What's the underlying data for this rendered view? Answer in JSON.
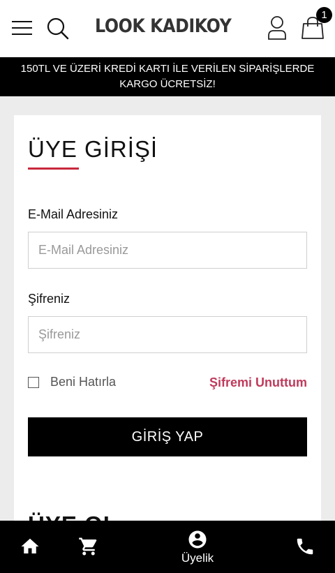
{
  "header": {
    "menu_icon": "hamburger-menu-icon",
    "search_icon": "search-icon",
    "logo_text": "LOOK KADIKOY",
    "user_icon": "user-icon",
    "cart_icon": "shopping-bag-icon",
    "cart_count": "1"
  },
  "promo": {
    "line1": "150TL VE ÜZERİ KREDİ KARTI İLE VERİLEN SİPARİŞLERDE",
    "line2": "KARGO ÜCRETSİZ!"
  },
  "login": {
    "title": "ÜYE GİRİŞİ",
    "email_label": "E-Mail Adresiniz",
    "email_placeholder": "E-Mail Adresiniz",
    "email_value": "",
    "password_label": "Şifreniz",
    "password_placeholder": "Şifreniz",
    "password_value": "",
    "remember_label": "Beni Hatırla",
    "remember_checked": false,
    "forgot_label": "Şifremi Unuttum",
    "submit_label": "GİRİŞ YAP"
  },
  "register_peek": {
    "title": "ÜYE OL"
  },
  "bottom_nav": {
    "home_icon": "home-icon",
    "cart_icon": "cart-icon",
    "account_icon": "account-circle-icon",
    "account_label": "Üyelik",
    "phone_icon": "phone-icon"
  },
  "colors": {
    "accent": "#c8283c",
    "link": "#c03a5b",
    "promo_bg": "#000000",
    "page_bg": "#ececec"
  }
}
